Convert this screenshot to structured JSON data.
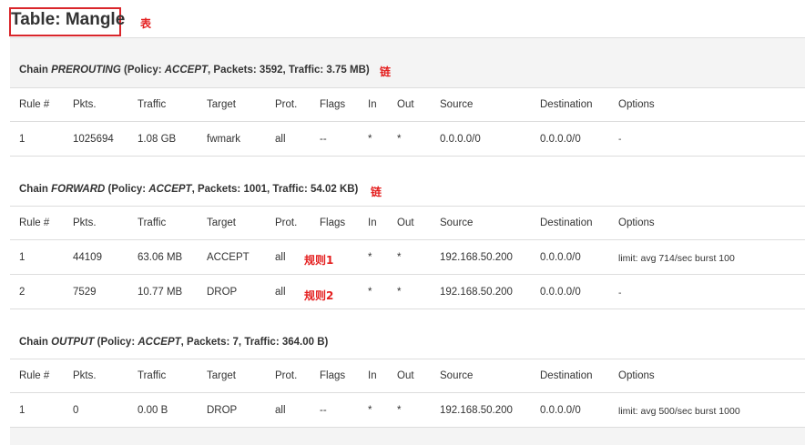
{
  "page": {
    "title": "Table: Mangle",
    "title_annotation": "表"
  },
  "columns": [
    "Rule #",
    "Pkts.",
    "Traffic",
    "Target",
    "Prot.",
    "Flags",
    "In",
    "Out",
    "Source",
    "Destination",
    "Options"
  ],
  "chains": [
    {
      "prefix": "Chain ",
      "name": "PREROUTING",
      "policy_prefix": " (Policy: ",
      "policy": "ACCEPT",
      "stats": ", Packets: 3592, Traffic: 3.75 MB)",
      "annotation": "链",
      "rows": [
        {
          "rule": "1",
          "pkts": "1025694",
          "traffic": "1.08 GB",
          "target": "fwmark",
          "prot": "all",
          "flags": "--",
          "in": "*",
          "out": "*",
          "source": "0.0.0.0/0",
          "destination": "0.0.0.0/0",
          "options": "-",
          "annotation": ""
        }
      ]
    },
    {
      "prefix": "Chain ",
      "name": "FORWARD",
      "policy_prefix": " (Policy: ",
      "policy": "ACCEPT",
      "stats": ", Packets: 1001, Traffic: 54.02 KB)",
      "annotation": "链",
      "rows": [
        {
          "rule": "1",
          "pkts": "44109",
          "traffic": "63.06 MB",
          "target": "ACCEPT",
          "prot": "all",
          "flags": "",
          "in": "*",
          "out": "*",
          "source": "192.168.50.200",
          "destination": "0.0.0.0/0",
          "options": "limit: avg 714/sec burst 100",
          "annotation": "规则1"
        },
        {
          "rule": "2",
          "pkts": "7529",
          "traffic": "10.77 MB",
          "target": "DROP",
          "prot": "all",
          "flags": "",
          "in": "*",
          "out": "*",
          "source": "192.168.50.200",
          "destination": "0.0.0.0/0",
          "options": "-",
          "annotation": "规则2"
        }
      ]
    },
    {
      "prefix": "Chain ",
      "name": "OUTPUT",
      "policy_prefix": " (Policy: ",
      "policy": "ACCEPT",
      "stats": ", Packets: 7, Traffic: 364.00 B)",
      "annotation": "",
      "rows": [
        {
          "rule": "1",
          "pkts": "0",
          "traffic": "0.00 B",
          "target": "DROP",
          "prot": "all",
          "flags": "--",
          "in": "*",
          "out": "*",
          "source": "192.168.50.200",
          "destination": "0.0.0.0/0",
          "options": "limit: avg 500/sec burst 1000",
          "annotation": ""
        }
      ]
    }
  ]
}
